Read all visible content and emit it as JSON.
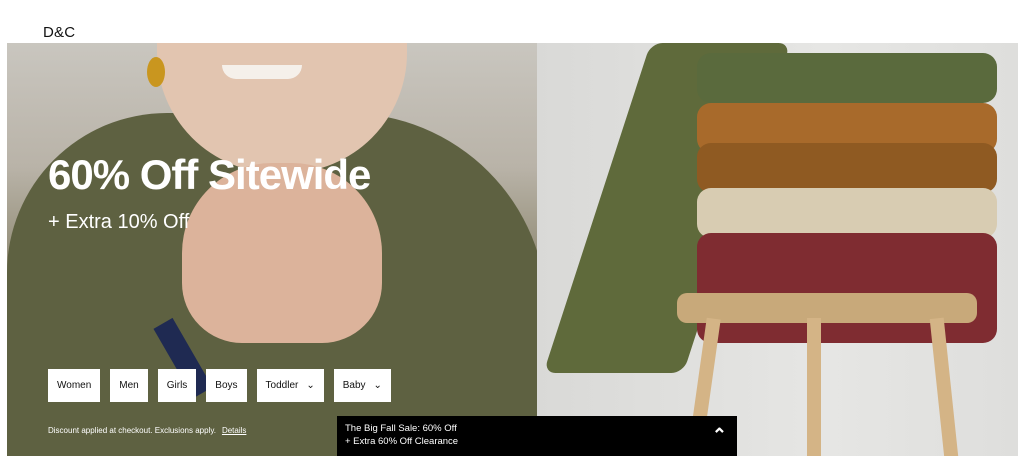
{
  "brand": {
    "name": "D&C"
  },
  "hero": {
    "headline": "60% Off Sitewide",
    "subline": "+ Extra 10% Off",
    "categories": [
      {
        "label": "Women",
        "dropdown": false
      },
      {
        "label": "Men",
        "dropdown": false
      },
      {
        "label": "Girls",
        "dropdown": false
      },
      {
        "label": "Boys",
        "dropdown": false
      },
      {
        "label": "Toddler",
        "dropdown": true
      },
      {
        "label": "Baby",
        "dropdown": true
      }
    ],
    "disclaimer": "Discount applied at checkout. Exclusions apply.",
    "details_link": "Details"
  },
  "sale_bar": {
    "line1": "The Big Fall Sale: 60% Off",
    "line2": "+ Extra 60% Off Clearance",
    "toggle_icon": "chevron-up-icon"
  },
  "colors": {
    "bar_background": "#000000",
    "text_on_hero": "#ffffff",
    "chip_background": "#ffffff"
  }
}
